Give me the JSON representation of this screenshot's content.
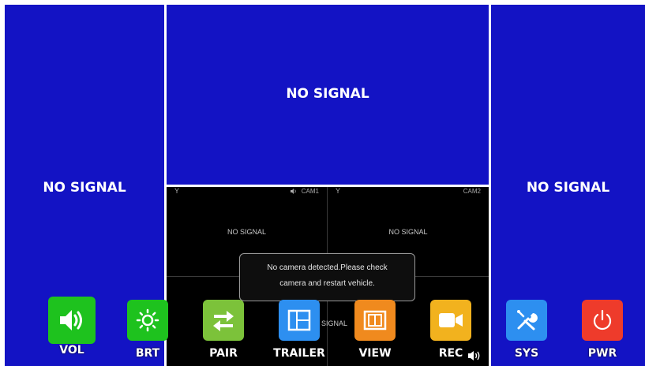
{
  "panes": {
    "left": {
      "text": "NO SIGNAL"
    },
    "top": {
      "text": "NO SIGNAL"
    },
    "right": {
      "text": "NO SIGNAL"
    }
  },
  "inset": {
    "cam1": {
      "corner": "Y",
      "tag": "CAM1",
      "text": "NO SIGNAL"
    },
    "cam2": {
      "corner": "Y",
      "tag": "CAM2",
      "text": "NO SIGNAL"
    },
    "cam4": {
      "text": "SIGNAL"
    }
  },
  "toast": {
    "line1": "No camera detected.Please check",
    "line2": "camera and restart vehicle."
  },
  "toolbar": {
    "buttons": [
      {
        "label": "VOL",
        "icon": "speaker-icon",
        "color": "#1ec21e"
      },
      {
        "label": "BRT",
        "icon": "sun-icon",
        "color": "#1ec21e"
      },
      {
        "label": "PAIR",
        "icon": "swap-arrows-icon",
        "color": "#7cc23a"
      },
      {
        "label": "TRAILER",
        "icon": "trailer-layout-icon",
        "color": "#2d8ff0"
      },
      {
        "label": "VIEW",
        "icon": "view-layout-icon",
        "color": "#f08a1e"
      },
      {
        "label": "REC",
        "icon": "video-camera-icon",
        "color": "#f2b21e"
      },
      {
        "label": "SYS",
        "icon": "tools-icon",
        "color": "#2d8ff0"
      },
      {
        "label": "PWR",
        "icon": "power-icon",
        "color": "#ee3b2b"
      }
    ]
  }
}
